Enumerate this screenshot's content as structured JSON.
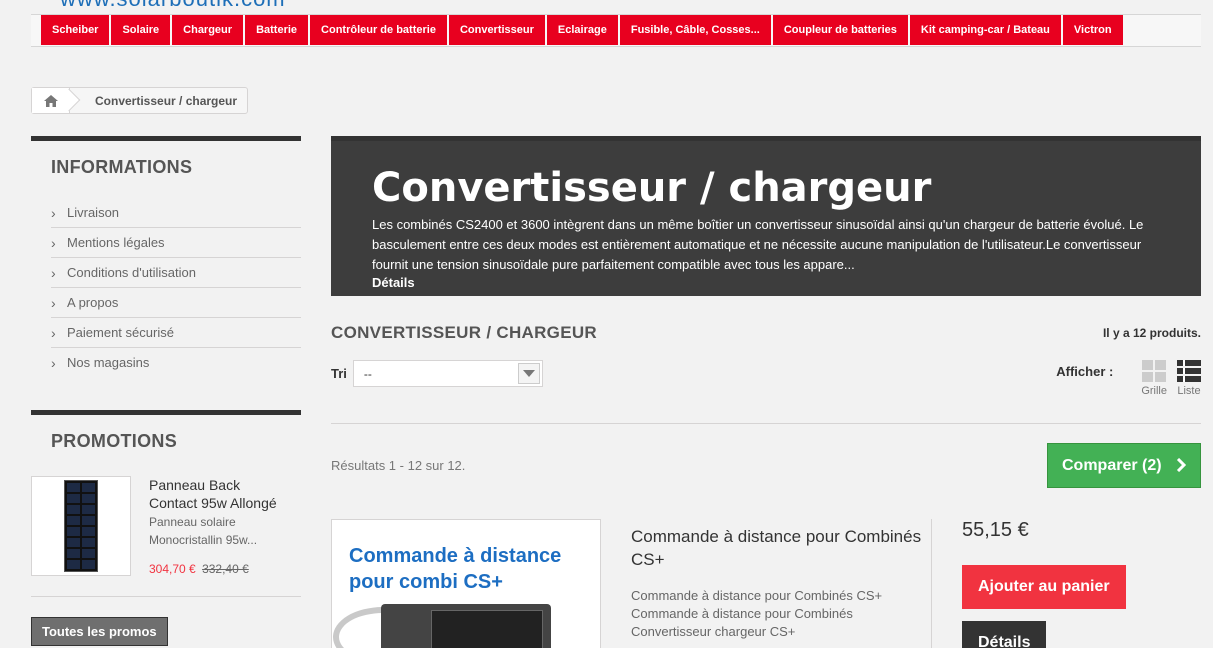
{
  "site": {
    "logo_text": "www.solarboutik.com"
  },
  "topnav": {
    "items": [
      "Scheiber",
      "Solaire",
      "Chargeur",
      "Batterie",
      "Contrôleur de batterie",
      "Convertisseur",
      "Eclairage",
      "Fusible, Câble, Cosses...",
      "Coupleur de batteries",
      "Kit camping-car / Bateau",
      "Victron"
    ]
  },
  "breadcrumb": {
    "current": "Convertisseur / chargeur"
  },
  "sidebar": {
    "info_title": "INFORMATIONS",
    "info_items": [
      "Livraison",
      "Mentions légales",
      "Conditions d'utilisation",
      "A propos",
      "Paiement sécurisé",
      "Nos magasins"
    ],
    "promo_title": "PROMOTIONS",
    "promo": {
      "name": "Panneau Back Contact 95w Allongé",
      "desc": "Panneau solaire Monocristallin 95w...",
      "price": "304,70 €",
      "old_price": "332,40 €"
    },
    "all_promos": "Toutes les promos"
  },
  "category": {
    "title": "Convertisseur / chargeur",
    "description": "Les combinés CS2400 et 3600 intègrent dans un même boîtier un convertisseur sinusoïdal ainsi qu'un chargeur de batterie évolué. Le basculement entre ces deux modes est entièrement automatique et ne nécessite aucune manipulation de l'utilisateur.Le convertisseur fournit une tension sinusoïdale pure parfaitement compatible avec tous les appare...",
    "more_label": "Détails"
  },
  "listing": {
    "heading": "CONVERTISSEUR / CHARGEUR",
    "count_text": "Il y a 12 produits.",
    "sort_label": "Tri",
    "sort_value": "--",
    "view_label": "Afficher :",
    "view_grid": "Grille",
    "view_list": "Liste",
    "results_text": "Résultats 1 - 12 sur 12.",
    "compare_label": "Comparer (2)"
  },
  "product": {
    "image_caption": "Commande à distance pour combi CS+",
    "name": "Commande à distance pour Combinés CS+",
    "description": "Commande à distance pour Combinés CS+ Commande à distance pour Combinés Convertisseur chargeur CS+",
    "price": "55,15 €",
    "add_to_cart": "Ajouter au panier",
    "details": "Détails"
  },
  "colors": {
    "nav_red": "#e8001f",
    "banner_bg": "#3d3d3d",
    "compare_green": "#43b155",
    "cart_red": "#f13340"
  }
}
